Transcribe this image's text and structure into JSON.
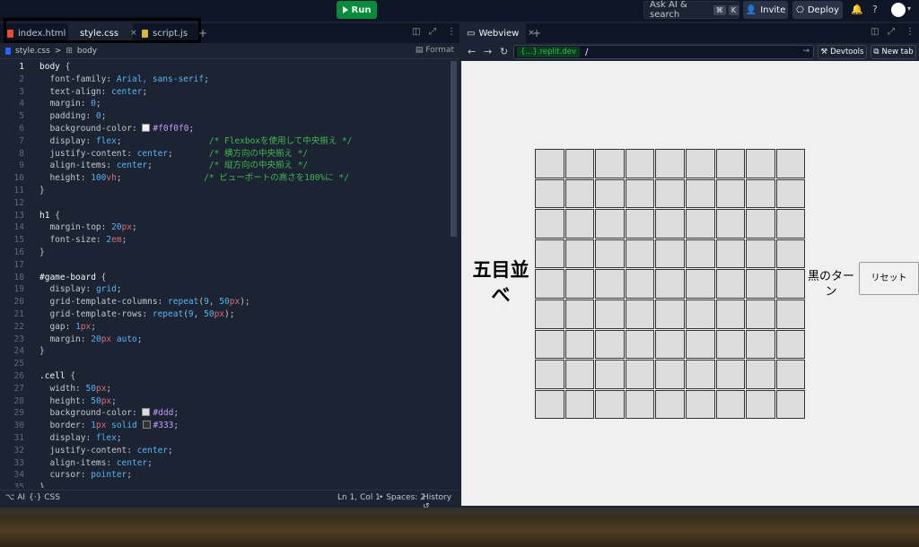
{
  "topbar": {
    "run_label": "Run",
    "search_label": "Ask AI & search",
    "search_kbd": [
      "⌘",
      "K"
    ],
    "invite_label": "Invite",
    "deploy_label": "Deploy",
    "bell_icon": "🔔",
    "help_icon": "?"
  },
  "editor": {
    "tabs": [
      {
        "label": "index.html",
        "icon_color": "#e44d26"
      },
      {
        "label": "style.css",
        "icon_color": "#2965f1"
      },
      {
        "label": "script.js",
        "icon_color": "#d9b63b"
      }
    ],
    "add_tab": "+",
    "breadcrumb": {
      "file": "style.css",
      "sep": ">",
      "node": "body"
    },
    "format_label": "Format",
    "status": {
      "ai": "AI",
      "lang": "CSS",
      "position": "Ln 1, Col 1",
      "spaces": "Spaces: 2",
      "history": "History"
    },
    "lines": [
      {
        "n": "1",
        "html": "<span class='sel'>body</span> <span class='p'>{</span>"
      },
      {
        "n": "2",
        "html": "  <span class='p'>font-family:</span> <span class='v'>Arial, sans-serif</span><span class='p'>;</span>"
      },
      {
        "n": "3",
        "html": "  <span class='p'>text-align:</span> <span class='v'>center</span><span class='p'>;</span>"
      },
      {
        "n": "4",
        "html": "  <span class='p'>margin:</span> <span class='n'>0</span><span class='p'>;</span>"
      },
      {
        "n": "5",
        "html": "  <span class='p'>padding:</span> <span class='n'>0</span><span class='p'>;</span>"
      },
      {
        "n": "6",
        "html": "  <span class='p'>background-color:</span> <span class='swatch' style='background:#f0f0f0'></span><span class='h'>#f0f0f0</span><span class='p'>;</span>"
      },
      {
        "n": "7",
        "html": "  <span class='p'>display:</span> <span class='v'>flex</span><span class='p'>;</span>                 <span class='c'>/* Flexboxを使用して中央揃え */</span>"
      },
      {
        "n": "8",
        "html": "  <span class='p'>justify-content:</span> <span class='v'>center</span><span class='p'>;</span>       <span class='c'>/* 横方向の中央揃え */</span>"
      },
      {
        "n": "9",
        "html": "  <span class='p'>align-items:</span> <span class='v'>center</span><span class='p'>;</span>           <span class='c'>/* 縦方向の中央揃え */</span>"
      },
      {
        "n": "10",
        "html": "  <span class='p'>height:</span> <span class='n'>100</span><span class='u'>vh</span><span class='p'>;</span>                <span class='c'>/* ビューポートの高さを100%に */</span>"
      },
      {
        "n": "11",
        "html": "<span class='p'>}</span>"
      },
      {
        "n": "12",
        "html": ""
      },
      {
        "n": "13",
        "html": "<span class='sel'>h1</span> <span class='p'>{</span>"
      },
      {
        "n": "14",
        "html": "  <span class='p'>margin-top:</span> <span class='n'>20</span><span class='u'>px</span><span class='p'>;</span>"
      },
      {
        "n": "15",
        "html": "  <span class='p'>font-size:</span> <span class='n'>2</span><span class='u'>em</span><span class='p'>;</span>"
      },
      {
        "n": "16",
        "html": "<span class='p'>}</span>"
      },
      {
        "n": "17",
        "html": ""
      },
      {
        "n": "18",
        "html": "<span class='sel'>#game-board</span> <span class='p'>{</span>"
      },
      {
        "n": "19",
        "html": "  <span class='p'>display:</span> <span class='v'>grid</span><span class='p'>;</span>"
      },
      {
        "n": "20",
        "html": "  <span class='p'>grid-template-columns:</span> <span class='v'>repeat</span><span class='p'>(</span><span class='n'>9</span><span class='p'>,</span> <span class='n'>50</span><span class='u'>px</span><span class='p'>);</span>"
      },
      {
        "n": "21",
        "html": "  <span class='p'>grid-template-rows:</span> <span class='v'>repeat</span><span class='p'>(</span><span class='n'>9</span><span class='p'>,</span> <span class='n'>50</span><span class='u'>px</span><span class='p'>);</span>"
      },
      {
        "n": "22",
        "html": "  <span class='p'>gap:</span> <span class='n'>1</span><span class='u'>px</span><span class='p'>;</span>"
      },
      {
        "n": "23",
        "html": "  <span class='p'>margin:</span> <span class='n'>20</span><span class='u'>px</span> <span class='v'>auto</span><span class='p'>;</span>"
      },
      {
        "n": "24",
        "html": "<span class='p'>}</span>"
      },
      {
        "n": "25",
        "html": ""
      },
      {
        "n": "26",
        "html": "<span class='sel'>.cell</span> <span class='p'>{</span>"
      },
      {
        "n": "27",
        "html": "  <span class='p'>width:</span> <span class='n'>50</span><span class='u'>px</span><span class='p'>;</span>"
      },
      {
        "n": "28",
        "html": "  <span class='p'>height:</span> <span class='n'>50</span><span class='u'>px</span><span class='p'>;</span>"
      },
      {
        "n": "29",
        "html": "  <span class='p'>background-color:</span> <span class='swatch' style='background:#ddd'></span><span class='h'>#ddd</span><span class='p'>;</span>"
      },
      {
        "n": "30",
        "html": "  <span class='p'>border:</span> <span class='n'>1</span><span class='u'>px</span> <span class='v'>solid</span> <span class='swatch' style='background:#333'></span><span class='h'>#333</span><span class='p'>;</span>"
      },
      {
        "n": "31",
        "html": "  <span class='p'>display:</span> <span class='v'>flex</span><span class='p'>;</span>"
      },
      {
        "n": "32",
        "html": "  <span class='p'>justify-content:</span> <span class='v'>center</span><span class='p'>;</span>"
      },
      {
        "n": "33",
        "html": "  <span class='p'>align-items:</span> <span class='v'>center</span><span class='p'>;</span>"
      },
      {
        "n": "34",
        "html": "  <span class='p'>cursor:</span> <span class='v'>pointer</span><span class='p'>;</span>"
      },
      {
        "n": "35",
        "html": "<span class='p'>}</span>"
      }
    ]
  },
  "webview": {
    "tab_label": "Webview",
    "add_tab": "+",
    "url_domain": "{...}.replit.dev",
    "url_path": "/",
    "devtools_label": "Devtools",
    "newtab_label": "New tab",
    "game": {
      "title": "五目並べ",
      "rows": 9,
      "cols": 9,
      "turn_text": "黒のターン",
      "reset_label": "リセット"
    }
  },
  "colors": {
    "accent_run": "#0b8a3e",
    "editor_bg": "#1c2333",
    "chrome_bg": "#0e1525",
    "cell_bg": "#dddddd",
    "page_bg": "#f0f0f0"
  }
}
